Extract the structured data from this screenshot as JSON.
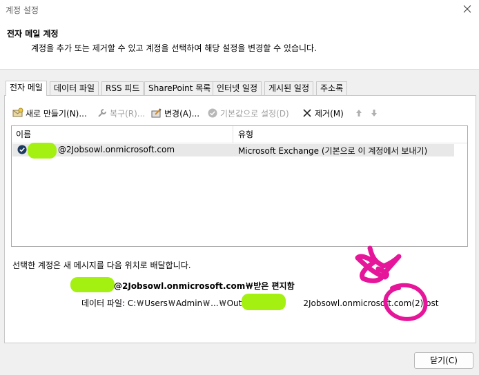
{
  "window": {
    "title": "계정 설정",
    "close_icon": "close-icon"
  },
  "header": {
    "title": "전자 메일 계정",
    "description": "계정을 추가 또는 제거할 수 있고 계정을 선택하여 해당 설정을 변경할 수 있습니다."
  },
  "tabs": [
    {
      "label": "전자 메일",
      "active": true
    },
    {
      "label": "데이터 파일"
    },
    {
      "label": "RSS 피드"
    },
    {
      "label": "SharePoint 목록"
    },
    {
      "label": "인터넷 일정"
    },
    {
      "label": "게시된 일정"
    },
    {
      "label": "주소록"
    }
  ],
  "toolbar": {
    "new_label": "새로 만들기(N)...",
    "repair_label": "복구(R)...",
    "change_label": "변경(A)...",
    "default_label": "기본값으로 설정(D)",
    "remove_label": "제거(M)"
  },
  "list": {
    "columns": [
      "이름",
      "유형"
    ],
    "rows": [
      {
        "name": "@2Jobsowl.onmicrosoft.com",
        "type": "Microsoft Exchange (기본으로 이 계정에서 보내기)"
      }
    ]
  },
  "delivery": {
    "label": "선택한 계정은 새 메시지를 다음 위치로 배달합니다.",
    "inbox": "@2Jobsowl.onmicrosoft.com￦받은 편지함",
    "data_file_prefix": "데이터 파일: C:￦Users￦Admin￦...￦Outlook",
    "data_file_suffix": "2Jobsowl.onmicrosoft.com(2).ost"
  },
  "buttons": {
    "close_label": "닫기(C)"
  },
  "colors": {
    "redaction": "#a3f011",
    "annotation": "#e6169a"
  }
}
